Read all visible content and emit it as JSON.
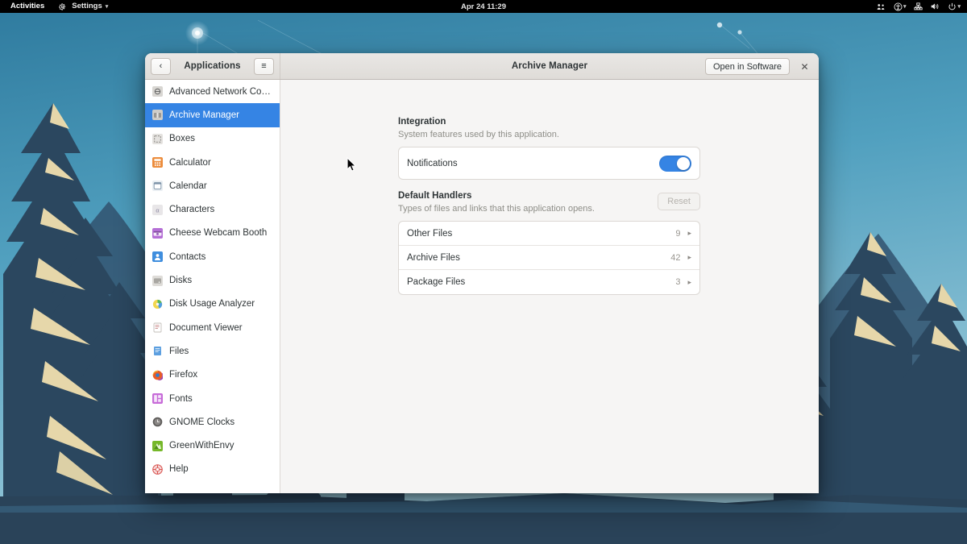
{
  "topbar": {
    "activities": "Activities",
    "app_menu": {
      "label": "Settings",
      "icon": "gear-icon",
      "caret": "▾"
    },
    "clock": "Apr 24  11:29",
    "tray": [
      {
        "name": "network-connections-icon"
      },
      {
        "name": "accessibility-icon",
        "caret": "▾"
      },
      {
        "name": "network-wired-icon"
      },
      {
        "name": "volume-icon"
      },
      {
        "name": "power-icon",
        "caret": "▾"
      }
    ]
  },
  "window": {
    "sidebar_header": {
      "back_label": "‹",
      "title": "Applications",
      "menu_label": "≡"
    },
    "content_header": {
      "title": "Archive Manager",
      "action_label": "Open in Software",
      "close_label": "✕"
    }
  },
  "sidebar": {
    "items": [
      {
        "label": "Advanced Network Configurati…",
        "icon": "network-config-icon",
        "selected": false
      },
      {
        "label": "Archive Manager",
        "icon": "archive-manager-icon",
        "selected": true
      },
      {
        "label": "Boxes",
        "icon": "boxes-icon",
        "selected": false
      },
      {
        "label": "Calculator",
        "icon": "calculator-icon",
        "selected": false
      },
      {
        "label": "Calendar",
        "icon": "calendar-icon",
        "selected": false
      },
      {
        "label": "Characters",
        "icon": "characters-icon",
        "selected": false
      },
      {
        "label": "Cheese Webcam Booth",
        "icon": "cheese-icon",
        "selected": false
      },
      {
        "label": "Contacts",
        "icon": "contacts-icon",
        "selected": false
      },
      {
        "label": "Disks",
        "icon": "disks-icon",
        "selected": false
      },
      {
        "label": "Disk Usage Analyzer",
        "icon": "disk-usage-icon",
        "selected": false
      },
      {
        "label": "Document Viewer",
        "icon": "document-viewer-icon",
        "selected": false
      },
      {
        "label": "Files",
        "icon": "files-icon",
        "selected": false
      },
      {
        "label": "Firefox",
        "icon": "firefox-icon",
        "selected": false
      },
      {
        "label": "Fonts",
        "icon": "fonts-icon",
        "selected": false
      },
      {
        "label": "GNOME Clocks",
        "icon": "clocks-icon",
        "selected": false
      },
      {
        "label": "GreenWithEnvy",
        "icon": "greenwithenvy-icon",
        "selected": false
      },
      {
        "label": "Help",
        "icon": "help-icon",
        "selected": false
      }
    ]
  },
  "main": {
    "integration": {
      "title": "Integration",
      "subtitle": "System features used by this application.",
      "rows": [
        {
          "label": "Notifications",
          "toggle": true
        }
      ]
    },
    "default_handlers": {
      "title": "Default Handlers",
      "subtitle": "Types of files and links that this application opens.",
      "reset_label": "Reset",
      "rows": [
        {
          "label": "Other Files",
          "count": "9",
          "arrow": "▸"
        },
        {
          "label": "Archive Files",
          "count": "42",
          "arrow": "▸"
        },
        {
          "label": "Package Files",
          "count": "3",
          "arrow": "▸"
        }
      ]
    }
  },
  "colors": {
    "accent": "#3584e4",
    "sky_top": "#2b7ba0",
    "sky_bottom": "#8fc4d8",
    "tree": "#2c4a63",
    "ground": "#2a4359",
    "highlight": "#f0dfae"
  }
}
